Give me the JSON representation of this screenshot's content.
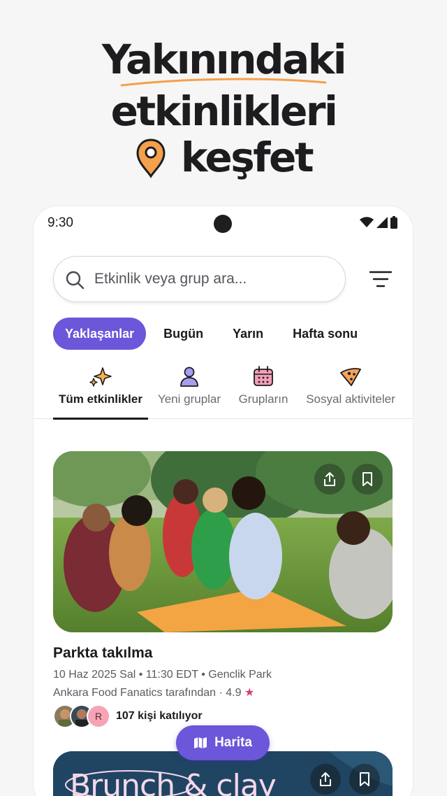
{
  "hero": {
    "line1": "Yakınındaki",
    "line2": "etkinlikleri",
    "line3": "keşfet"
  },
  "status_bar": {
    "time": "9:30"
  },
  "search": {
    "placeholder": "Etkinlik veya grup ara..."
  },
  "date_chips": [
    {
      "label": "Yaklaşanlar",
      "active": true
    },
    {
      "label": "Bugün",
      "active": false
    },
    {
      "label": "Yarın",
      "active": false
    },
    {
      "label": "Hafta sonu",
      "active": false
    }
  ],
  "category_tabs": [
    {
      "label": "Tüm etkinlikler",
      "icon": "sparkles-icon",
      "active": true
    },
    {
      "label": "Yeni gruplar",
      "icon": "person-icon",
      "active": false
    },
    {
      "label": "Grupların",
      "icon": "calendar-icon",
      "active": false
    },
    {
      "label": "Sosyal aktiviteler",
      "icon": "pizza-icon",
      "active": false
    }
  ],
  "events": [
    {
      "title": "Parkta takılma",
      "meta": "10 Haz 2025 Sal • 11:30 EDT • Genclik Park",
      "host": "Ankara Food Fanatics tarafından · 4.9",
      "attendee_initial": "R",
      "attendees": "107 kişi katılıyor"
    },
    {
      "image_text": "Brunch & clay"
    }
  ],
  "map_button": {
    "label": "Harita"
  },
  "colors": {
    "accent": "#6c56d9",
    "rating_star": "#d63f68",
    "pin_orange": "#f5a04a"
  }
}
